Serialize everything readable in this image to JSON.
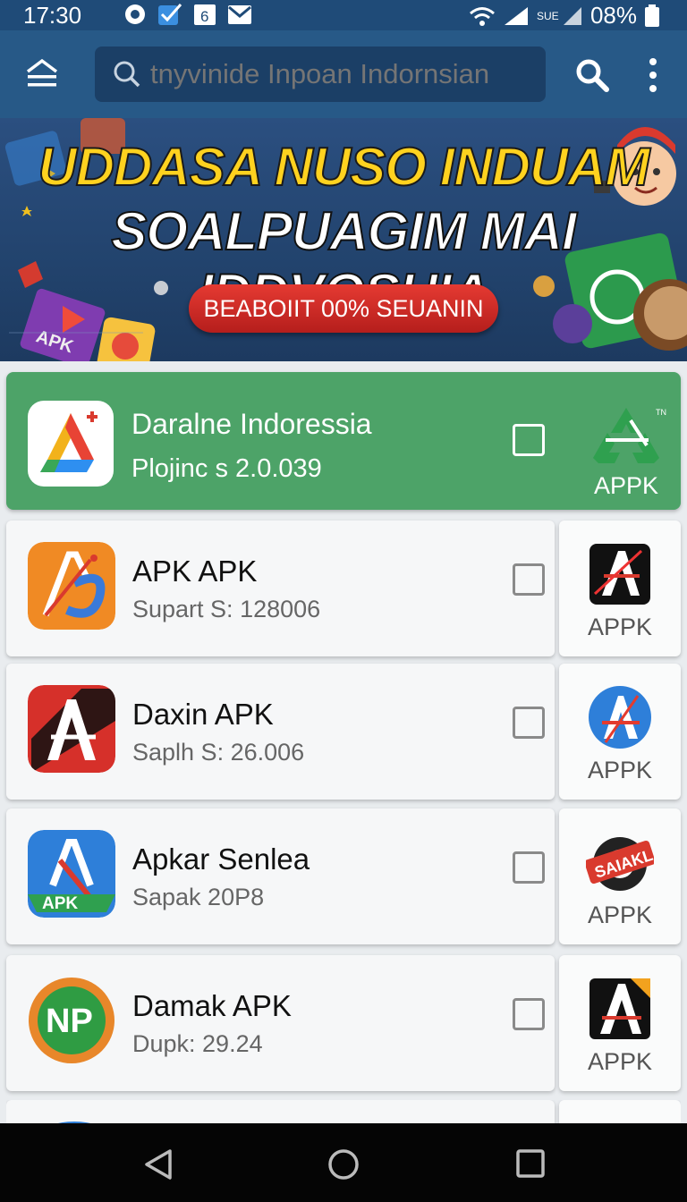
{
  "status_bar": {
    "time": "17:30",
    "battery": "08%",
    "network": "SUE"
  },
  "search": {
    "placeholder": "tnyvinide Inpoan Indornsian"
  },
  "banner": {
    "title_line1": "UDDASA NUSO INDUAM",
    "title_line2": "SOALPUAGIM MAI IDDVOSHIA",
    "cta": "BEABOIIT 00% SEUANIN",
    "apk_tag": "APK"
  },
  "featured": {
    "name": "Daralne Indoressia",
    "subtitle": "Plojinc s 2.0.039",
    "badge": "APPK"
  },
  "apps": [
    {
      "name": "APK APK",
      "subtitle": "Supart S: 128006",
      "badge": "APPK"
    },
    {
      "name": "Daxin APK",
      "subtitle": "Saplh S: 26.006",
      "badge": "APPK"
    },
    {
      "name": "Apkar Senlea",
      "subtitle": "Sapak 20P8",
      "badge": "APPK",
      "icon_tag": "APK",
      "badge_tag": "SAIAKL"
    },
    {
      "name": "Damak APK",
      "subtitle": "Dupk: 29.24",
      "badge": "APPK",
      "icon_tag": "NP"
    }
  ],
  "colors": {
    "appbar": "#275987",
    "featured": "#4da368",
    "cta": "#d42b27",
    "title_yellow": "#ffd21f"
  }
}
